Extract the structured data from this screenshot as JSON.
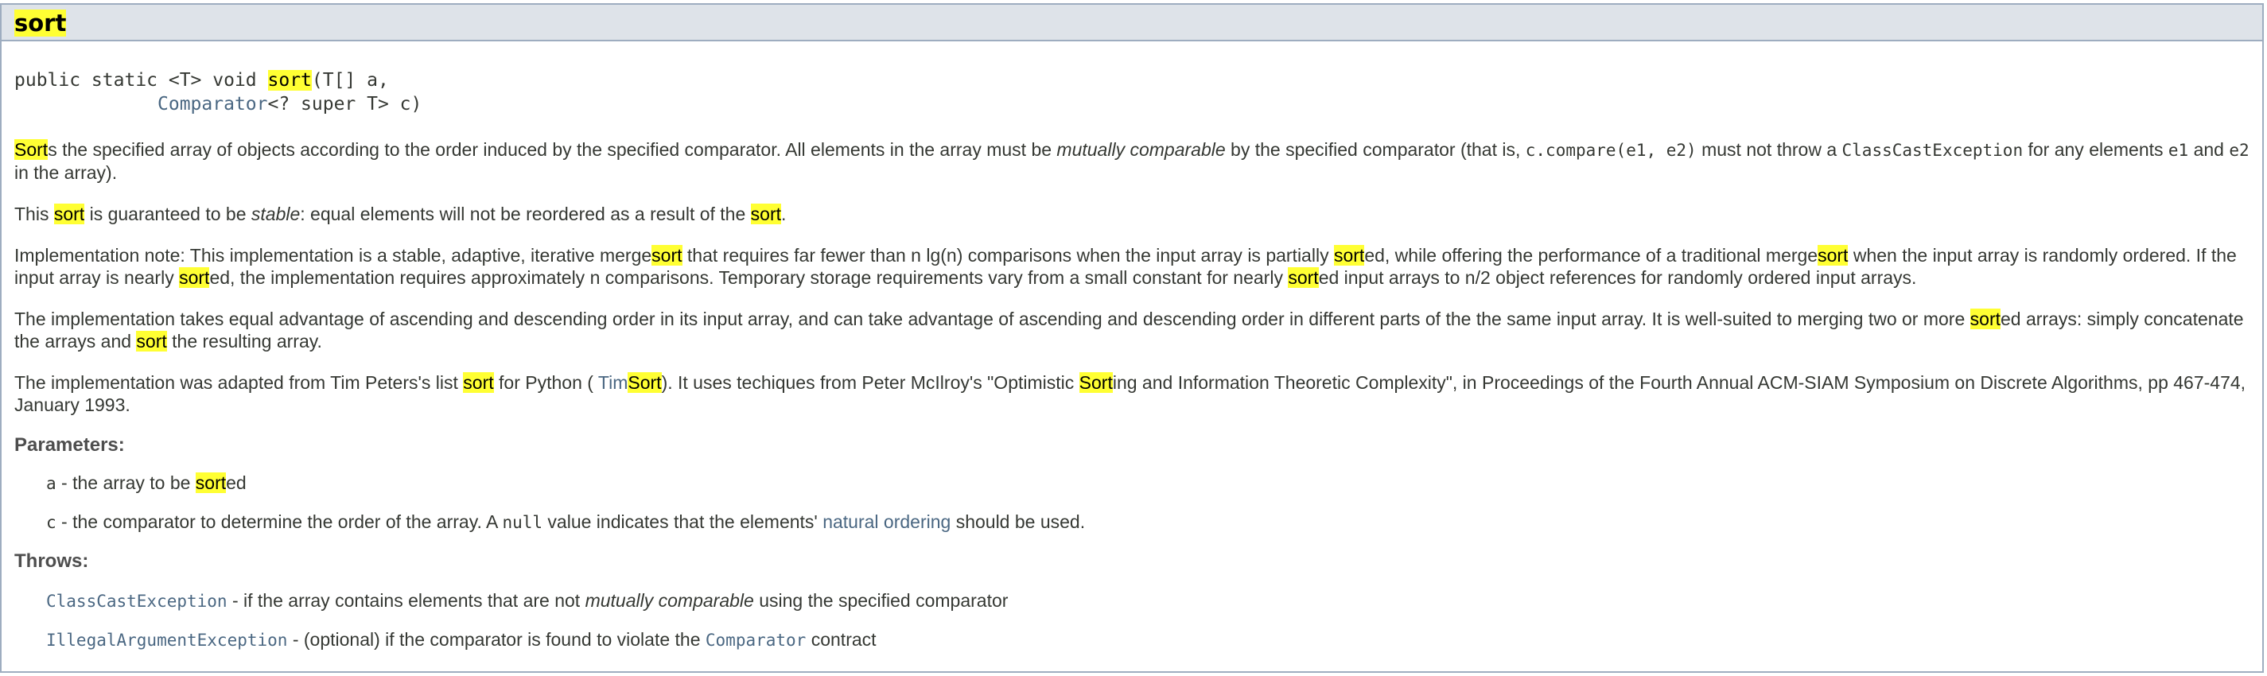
{
  "header": {
    "title_hl": "sort"
  },
  "signature": {
    "line1_pre": "public static <T> void ",
    "line1_hl": "sort",
    "line1_post": "(T[] a,",
    "line2_indent": "             ",
    "line2_link": "Comparator",
    "line2_post": "<? super T> c)"
  },
  "desc": {
    "p1": {
      "hl1": "Sort",
      "t1": "s the specified array of objects according to the order induced by the specified comparator. All elements in the array must be ",
      "em1": "mutually comparable",
      "t2": " by the specified comparator (that is, ",
      "code1": "c.compare(e1, e2)",
      "t3": " must not throw a ",
      "code2": "ClassCastException",
      "t4": " for any elements ",
      "code3": "e1",
      "t5": " and ",
      "code4": "e2",
      "t6": " in the array)."
    },
    "p2": {
      "t1": "This ",
      "hl1": "sort",
      "t2": " is guaranteed to be ",
      "em1": "stable",
      "t3": ": equal elements will not be reordered as a result of the ",
      "hl2": "sort",
      "t4": "."
    },
    "p3": {
      "t1": "Implementation note: This implementation is a stable, adaptive, iterative merge",
      "hl1": "sort",
      "t2": " that requires far fewer than n lg(n) comparisons when the input array is partially ",
      "hl2": "sort",
      "t3": "ed, while offering the performance of a traditional merge",
      "hl3": "sort",
      "t4": " when the input array is randomly ordered. If the input array is nearly ",
      "hl4": "sort",
      "t5": "ed, the implementation requires approximately n comparisons. Temporary storage requirements vary from a small constant for nearly ",
      "hl5": "sort",
      "t6": "ed input arrays to n/2 object references for randomly ordered input arrays."
    },
    "p4": {
      "t1": "The implementation takes equal advantage of ascending and descending order in its input array, and can take advantage of ascending and descending order in different parts of the the same input array. It is well-suited to merging two or more ",
      "hl1": "sort",
      "t2": "ed arrays: simply concatenate the arrays and ",
      "hl2": "sort",
      "t3": " the resulting array."
    },
    "p5": {
      "t1": "The implementation was adapted from Tim Peters's list ",
      "hl1": "sort",
      "t2": " for Python ( ",
      "link_pre": "Tim",
      "link_hl": "Sort",
      "t3": "). It uses techiques from Peter McIlroy's \"Optimistic ",
      "hl2": "Sort",
      "t4": "ing and Information Theoretic Complexity\", in Proceedings of the Fourth Annual ACM-SIAM Symposium on Discrete Algorithms, pp 467-474, January 1993."
    }
  },
  "params": {
    "label": "Parameters:",
    "a": {
      "code": "a",
      "t1": " - the array to be ",
      "hl": "sort",
      "t2": "ed"
    },
    "c": {
      "code": "c",
      "t1": " - the comparator to determine the order of the array. A ",
      "code2": "null",
      "t2": " value indicates that the elements' ",
      "link": "natural ordering",
      "t3": " should be used."
    }
  },
  "throws": {
    "label": "Throws:",
    "e1": {
      "code": "ClassCastException",
      "t1": " - if the array contains elements that are not ",
      "em": "mutually comparable",
      "t2": " using the specified comparator"
    },
    "e2": {
      "code": "IllegalArgumentException",
      "t1": " - (optional) if the comparator is found to violate the ",
      "code2": "Comparator",
      "t2": " contract"
    }
  },
  "colors": {
    "highlight": "#ffff33",
    "header_bg": "#dee3e9",
    "border": "#9eadc0",
    "link": "#4a6782",
    "text": "#353833"
  }
}
